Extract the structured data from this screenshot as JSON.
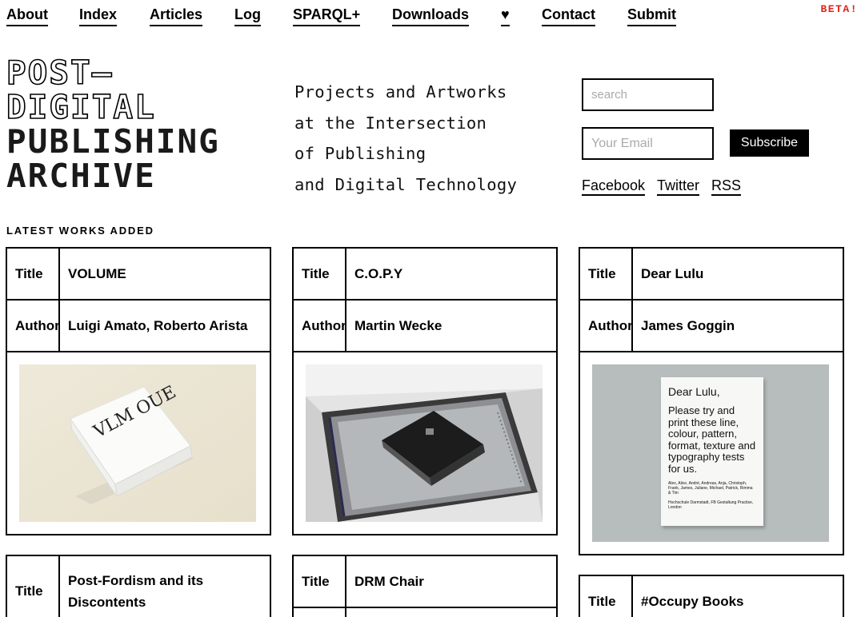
{
  "nav": {
    "items": [
      "About",
      "Index",
      "Articles",
      "Log",
      "SPARQL+",
      "Downloads",
      "♥",
      "Contact",
      "Submit"
    ],
    "beta": "BETA!"
  },
  "logo": {
    "line1": "POST—",
    "line2": "DIGITAL",
    "line3": "PUBLISHING",
    "line4": "ARCHIVE"
  },
  "tagline": [
    "Projects and Artworks",
    "at the Intersection",
    "of Publishing",
    "and Digital Technology"
  ],
  "search": {
    "placeholder": "search"
  },
  "newsletter": {
    "placeholder": "Your Email",
    "button": "Subscribe"
  },
  "social": [
    "Facebook",
    "Twitter",
    "RSS"
  ],
  "section_title": "LATEST WORKS ADDED",
  "labels": {
    "title": "Title",
    "author": "Author"
  },
  "works": [
    {
      "title": "VOLUME",
      "author": "Luigi Amato, Roberto Arista",
      "cover_text": "VLM OUE"
    },
    {
      "title": "C.O.P.Y",
      "author": "Martin Wecke"
    },
    {
      "title": "Dear Lulu",
      "author": "James Goggin",
      "cover_heading": "Dear Lulu,",
      "cover_body": "Please try and print these line, colour, pattern, format, texture and typography tests for us.",
      "cover_names": "Alex, Alice, André, Andreas, Anja, Christoph, Frank, James, Juliane, Michael, Patrick, Rimma & Tim",
      "cover_footer": "Hochschule Darmstadt, FB Gestaltung Practise, London"
    },
    {
      "title": "Post-Fordism and its Discontents"
    },
    {
      "title": "DRM Chair"
    },
    {
      "title": "#Occupy Books"
    }
  ],
  "colors": {
    "accent": "#e2231a",
    "text": "#000000"
  }
}
